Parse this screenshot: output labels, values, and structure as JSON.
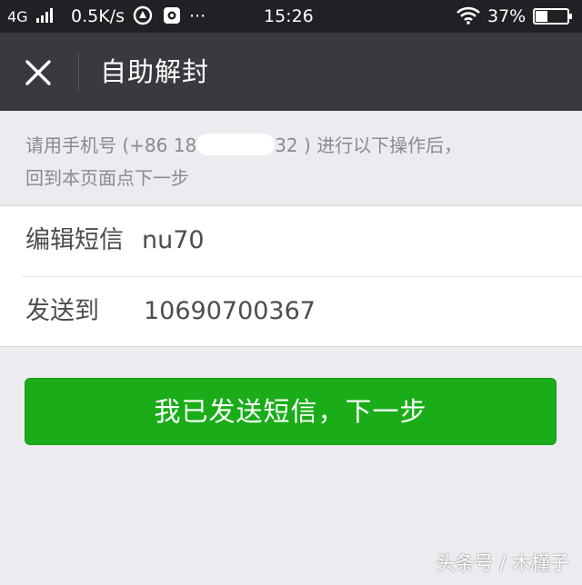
{
  "status_bar": {
    "network": "4G",
    "speed": "0.5K/s",
    "more": "···",
    "time": "15:26",
    "battery_percent": "37%",
    "battery_level": 0.37
  },
  "nav": {
    "title": "自助解封"
  },
  "instruction": {
    "prefix": "请用手机号 (+86 18",
    "suffix": "32 ) 进行以下操作后，",
    "line2": "回到本页面点下一步"
  },
  "rows": [
    {
      "label": "编辑短信",
      "value": "nu70"
    },
    {
      "label": "发送到",
      "value": "10690700367"
    }
  ],
  "primary_button": {
    "label": "我已发送短信，下一步"
  },
  "watermark": "头条号 / 木槿子",
  "colors": {
    "status_bar_bg": "#1f2124",
    "nav_bg": "#393a3f",
    "page_bg": "#ececf0",
    "button_green": "#1aad19",
    "muted_text": "#8a8a8f"
  }
}
